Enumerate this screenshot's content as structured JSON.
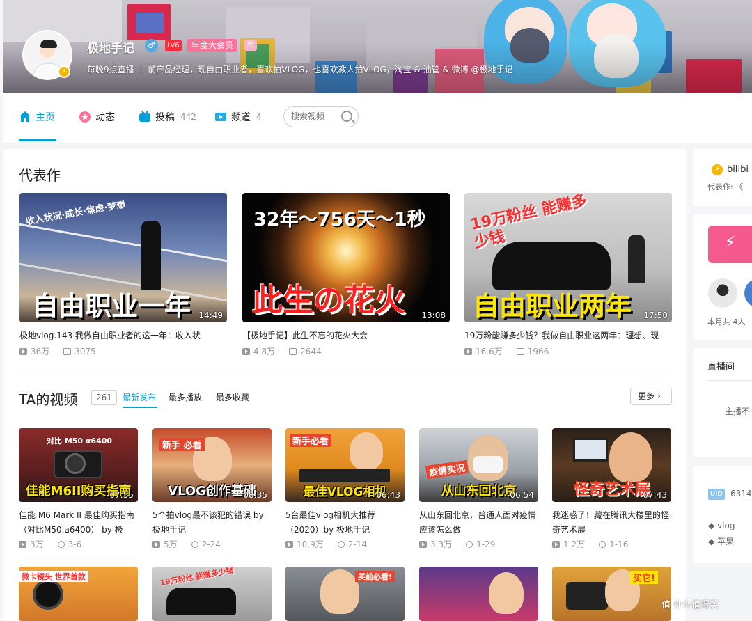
{
  "user": {
    "name": "极地手记",
    "gender_symbol": "♂",
    "level": "LV6",
    "vip_label": "年度大会员",
    "fan_badge": "粉",
    "signature": "每晚9点直播 ｜ 前产品经理，现自由职业者，喜欢拍VLOG，也喜欢教人拍VLOG，淘宝 & 油管 & 微博 @极地手记",
    "verify_symbol": "⚡"
  },
  "nav": {
    "home": "主页",
    "dynamic": "动态",
    "uploads": "投稿",
    "uploads_count": "442",
    "channels": "频道",
    "channels_count": "4",
    "search_placeholder": "搜索视频"
  },
  "featured": {
    "title": "代表作",
    "items": [
      {
        "title": "极地vlog.143 我做自由职业者的这一年：收入状",
        "duration": "14:49",
        "plays": "36万",
        "danmaku": "3075",
        "caption": "自由职业一年",
        "overlay": "收入状况·成长·焦虑·梦想"
      },
      {
        "title": "【极地手记】此生不忘的花火大会",
        "duration": "13:08",
        "plays": "4.8万",
        "danmaku": "2644",
        "caption": "此生の花火",
        "overlay": "32年～756天～1秒"
      },
      {
        "title": "19万粉能赚多少钱？我做自由职业这两年：理想、现",
        "duration": "17:50",
        "plays": "16.6万",
        "danmaku": "1966",
        "caption": "自由职业两年",
        "overlay": "19万粉丝 能赚多少钱"
      }
    ]
  },
  "videos": {
    "title": "TA的视频",
    "count": "261",
    "tabs": [
      "最新发布",
      "最多播放",
      "最多收藏"
    ],
    "more": "更多",
    "items": [
      {
        "title": "佳能 M6 Mark II 最佳购买指南（对比M50,a6400） by 极",
        "duration": "07:55",
        "plays": "3万",
        "date": "3-6",
        "caption": "佳能M6II购买指南",
        "tag": "对比 M50 α6400"
      },
      {
        "title": "5个拍vlog最不该犯的错误 by 极地手记",
        "duration": "08:35",
        "plays": "5万",
        "date": "2-24",
        "caption": "VLOG创作基础",
        "tag": "新手 必看"
      },
      {
        "title": "5台最佳vlog相机大推荐（2020）by 极地手记",
        "duration": "06:43",
        "plays": "10.9万",
        "date": "2-14",
        "caption": "最佳VLOG相机",
        "tag": "新手必看"
      },
      {
        "title": "从山东回北京，普通人面对疫情应该怎么做",
        "duration": "06:54",
        "plays": "3.3万",
        "date": "1-29",
        "caption": "从山东回北京",
        "tag": "疫情实况"
      },
      {
        "title": "我迷惑了！藏在腾讯大楼里的怪奇艺术展",
        "duration": "07:43",
        "plays": "1.2万",
        "date": "1-16",
        "caption": "怪奇艺术展",
        "tag": ""
      }
    ],
    "row2_tags": [
      "微卡镜头 世界首款",
      "19万粉丝 能赚多少钱",
      "买前必看!",
      "",
      "买它!"
    ]
  },
  "side": {
    "brand": "bilibi",
    "featured_label": "代表作: 《",
    "month_text": "本月共 4人",
    "live_title": "直播间",
    "live_text": "主播不",
    "uid_label": "UID",
    "uid_value": "6314",
    "tags": [
      "vlog",
      "苹果"
    ]
  },
  "watermark": "值 什么值得买",
  "colors": {
    "accent": "#00a1d6",
    "pink": "#fb7299",
    "level_red": "#ff2a3c"
  }
}
